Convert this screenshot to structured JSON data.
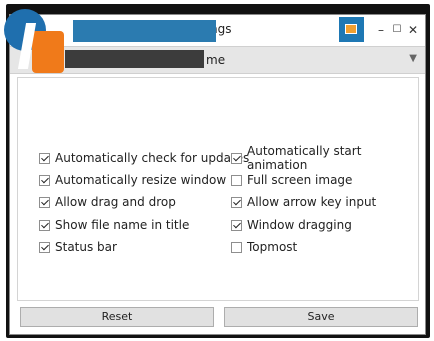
{
  "window": {
    "title_fragment": "ngs",
    "controls": {
      "minimize": "–",
      "maximize": "☐",
      "close": "✕"
    }
  },
  "dropdown": {
    "selected_fragment": "me",
    "arrow": "▼"
  },
  "options": {
    "left": [
      {
        "label": "Automatically check for updates",
        "checked": true
      },
      {
        "label": "Automatically resize window",
        "checked": true
      },
      {
        "label": "Allow drag and drop",
        "checked": true
      },
      {
        "label": "Show file name in title",
        "checked": true
      },
      {
        "label": "Status bar",
        "checked": true
      }
    ],
    "right": [
      {
        "label": "Automatically start animation",
        "checked": true
      },
      {
        "label": "Full screen image",
        "checked": false
      },
      {
        "label": "Allow arrow key input",
        "checked": true
      },
      {
        "label": "Window dragging",
        "checked": true
      },
      {
        "label": "Topmost",
        "checked": false
      }
    ]
  },
  "buttons": {
    "reset": "Reset",
    "save": "Save"
  },
  "colors": {
    "accent": "#1e78b4",
    "watermark_blue": "#1f6fae",
    "watermark_orange": "#f07a1a"
  }
}
